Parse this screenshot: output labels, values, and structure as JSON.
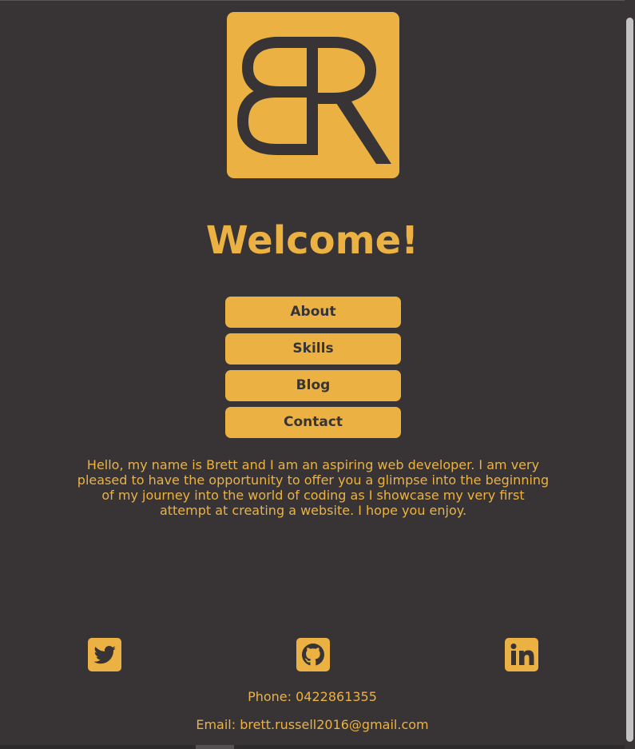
{
  "logo": {
    "alt": "BR logo"
  },
  "heading": "Welcome!",
  "nav": {
    "items": [
      {
        "label": "About"
      },
      {
        "label": "Skills"
      },
      {
        "label": "Blog"
      },
      {
        "label": "Contact"
      }
    ]
  },
  "intro": "Hello, my name is Brett and I am an aspiring web developer. I am very pleased to have the opportunity to offer you a glimpse into the beginning of my journey into the world of coding as I showcase my very first attempt at creating a website. I hope you enjoy.",
  "social": {
    "icons": [
      "twitter-icon",
      "github-icon",
      "linkedin-icon"
    ]
  },
  "contact": {
    "phone": "Phone: 0422861355",
    "email": "Email: brett.russell2016@gmail.com"
  },
  "colors": {
    "background": "#383435",
    "accent": "#ebb243"
  }
}
